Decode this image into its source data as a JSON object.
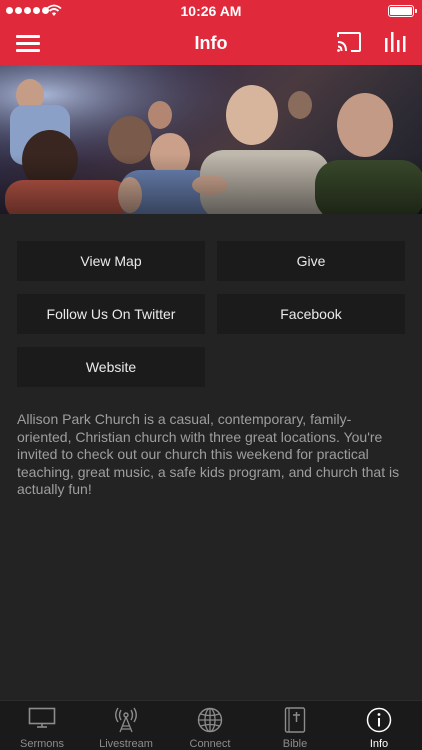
{
  "status_bar": {
    "time": "10:26 AM"
  },
  "header": {
    "title": "Info"
  },
  "buttons": {
    "view_map": "View Map",
    "give": "Give",
    "twitter": "Follow Us On Twitter",
    "facebook": "Facebook",
    "website": "Website"
  },
  "description": "Allison Park Church is a casual, contemporary, family-oriented, Christian church with three great locations. You're invited to check out our church this weekend for practical teaching, great music, a safe kids program, and church that is actually fun!",
  "tabs": [
    {
      "label": "Sermons",
      "icon": "tv-icon"
    },
    {
      "label": "Livestream",
      "icon": "antenna-icon"
    },
    {
      "label": "Connect",
      "icon": "globe-icon"
    },
    {
      "label": "Bible",
      "icon": "bible-icon"
    },
    {
      "label": "Info",
      "icon": "info-icon"
    }
  ],
  "colors": {
    "accent": "#e0293b",
    "background": "#232323",
    "button": "#1b1b1b"
  }
}
